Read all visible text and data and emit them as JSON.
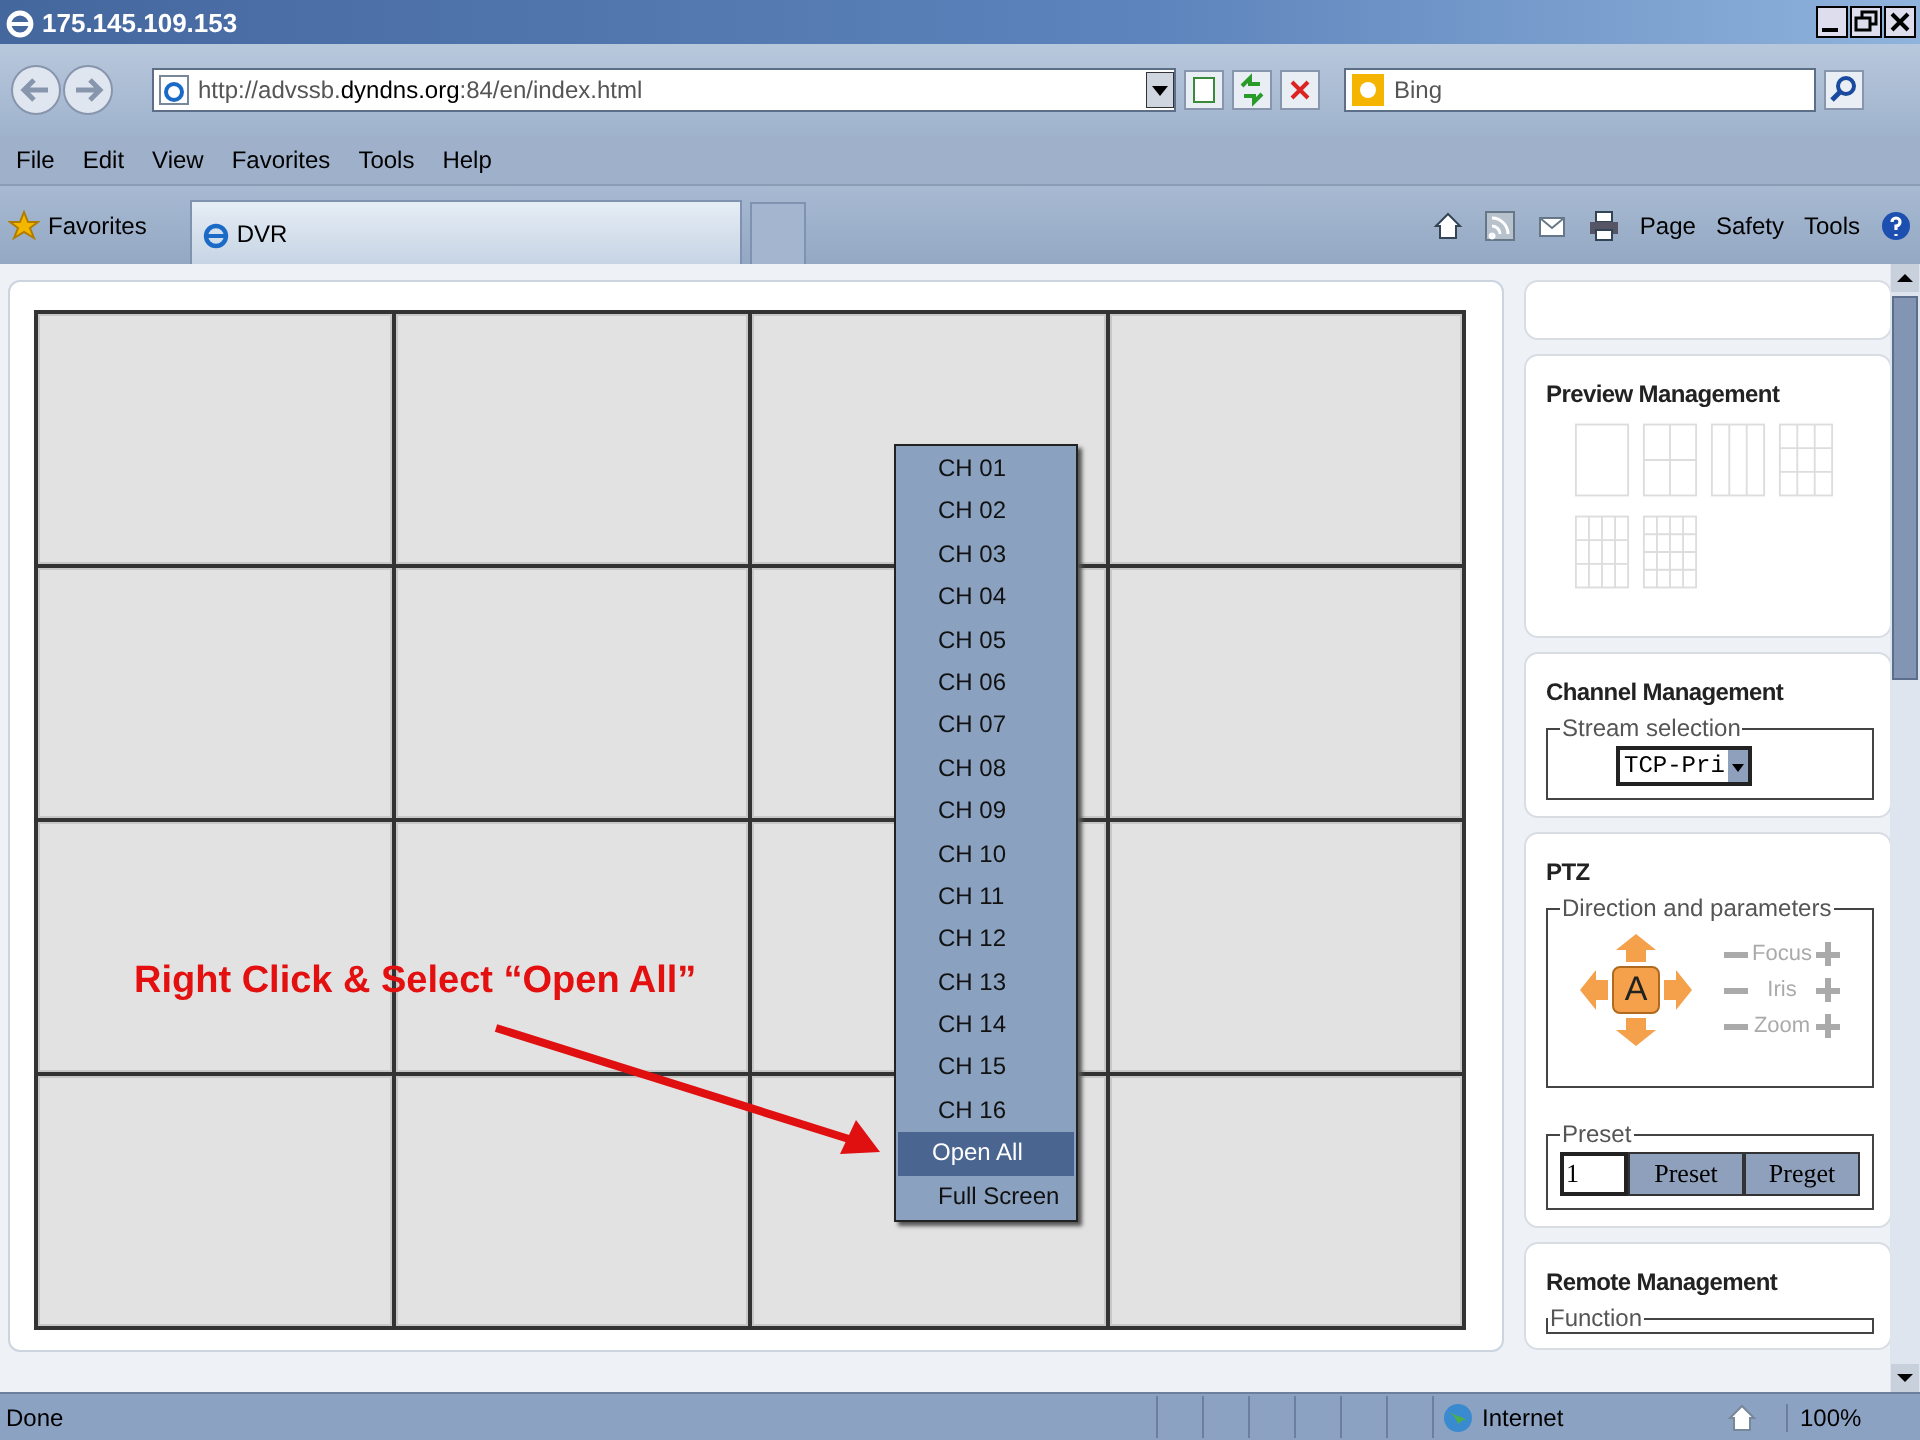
{
  "window": {
    "title": "175.145.109.153"
  },
  "address_bar": {
    "url": "http://advssb.**dyndns.org**:84/en/index.html",
    "search_placeholder": "Bing"
  },
  "menu_bar": [
    "File",
    "Edit",
    "View",
    "Favorites",
    "Tools",
    "Help"
  ],
  "favorites_bar": {
    "favorites": "Favorites",
    "tab": "DVR"
  },
  "command_bar": [
    "Page",
    "Safety",
    "Tools"
  ],
  "context_menu": [
    {
      "label": "CH 01",
      "selected": false
    },
    {
      "label": "CH 02",
      "selected": false
    },
    {
      "label": "CH 03",
      "selected": false
    },
    {
      "label": "CH 04",
      "selected": false
    },
    {
      "label": "CH 05",
      "selected": false
    },
    {
      "label": "CH 06",
      "selected": false
    },
    {
      "label": "CH 07",
      "selected": false
    },
    {
      "label": "CH 08",
      "selected": false
    },
    {
      "label": "CH 09",
      "selected": false
    },
    {
      "label": "CH 10",
      "selected": false
    },
    {
      "label": "CH 11",
      "selected": false
    },
    {
      "label": "CH 12",
      "selected": false
    },
    {
      "label": "CH 13",
      "selected": false
    },
    {
      "label": "CH 14",
      "selected": false
    },
    {
      "label": "CH 15",
      "selected": false
    },
    {
      "label": "CH 16",
      "selected": false
    },
    {
      "label": "Open All",
      "selected": true
    },
    {
      "label": "Full Screen",
      "selected": false
    }
  ],
  "annotation": "Right Click & Select “Open All”",
  "side_panel": {
    "preview_management": {
      "title": "Preview Management"
    },
    "channel_management": {
      "title": "Channel Management",
      "legend": "Stream selection",
      "stream": "TCP-Pri"
    },
    "ptz": {
      "title": "PTZ",
      "legend": "Direction and parameters",
      "center": "A",
      "params": [
        "Focus",
        "Iris",
        "Zoom"
      ],
      "preset_legend": "Preset",
      "preset_value": "1",
      "buttons": [
        "Preset",
        "Preget"
      ]
    },
    "remote_management": {
      "title": "Remote Management",
      "legend": "Function"
    }
  },
  "status_bar": {
    "text": "Done",
    "zone": "Internet",
    "zoom": "100%"
  }
}
